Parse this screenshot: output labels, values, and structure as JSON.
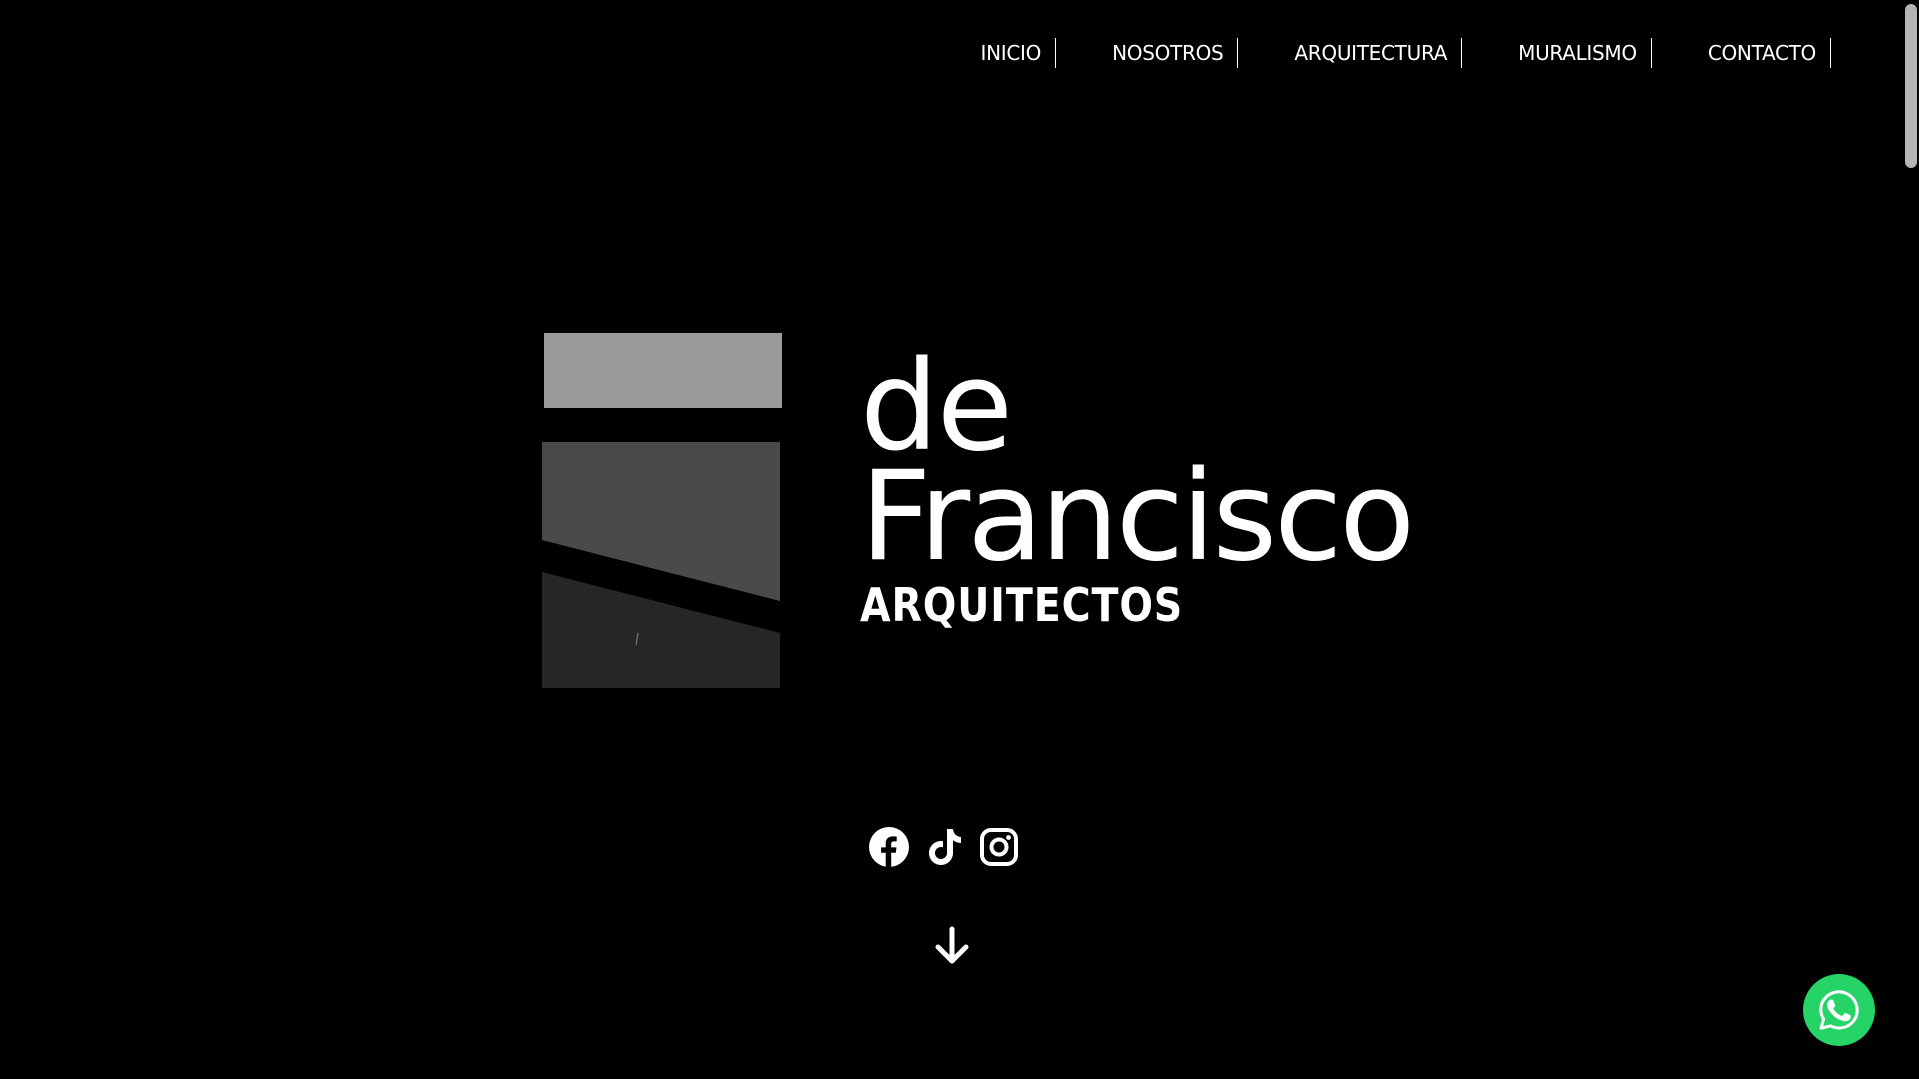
{
  "nav": {
    "items": [
      {
        "label": "INICIO"
      },
      {
        "label": "NOSOTROS"
      },
      {
        "label": "ARQUITECTURA"
      },
      {
        "label": "MURALISMO"
      },
      {
        "label": "CONTACTO"
      }
    ]
  },
  "logo": {
    "line1": "de",
    "line2": "Francisco",
    "subtitle": "ARQUITECTOS",
    "colors": {
      "top_block": "#9a9a9a",
      "middle_block": "#4a4a4c",
      "bottom_block": "#262626"
    }
  },
  "social": {
    "icons": [
      "facebook-icon",
      "tiktok-icon",
      "instagram-icon"
    ]
  },
  "scroll_down": {
    "icon": "arrow-down-icon"
  },
  "whatsapp": {
    "icon": "whatsapp-icon",
    "color": "#25d366"
  },
  "theme": {
    "background": "#000000",
    "text": "#ffffff"
  }
}
